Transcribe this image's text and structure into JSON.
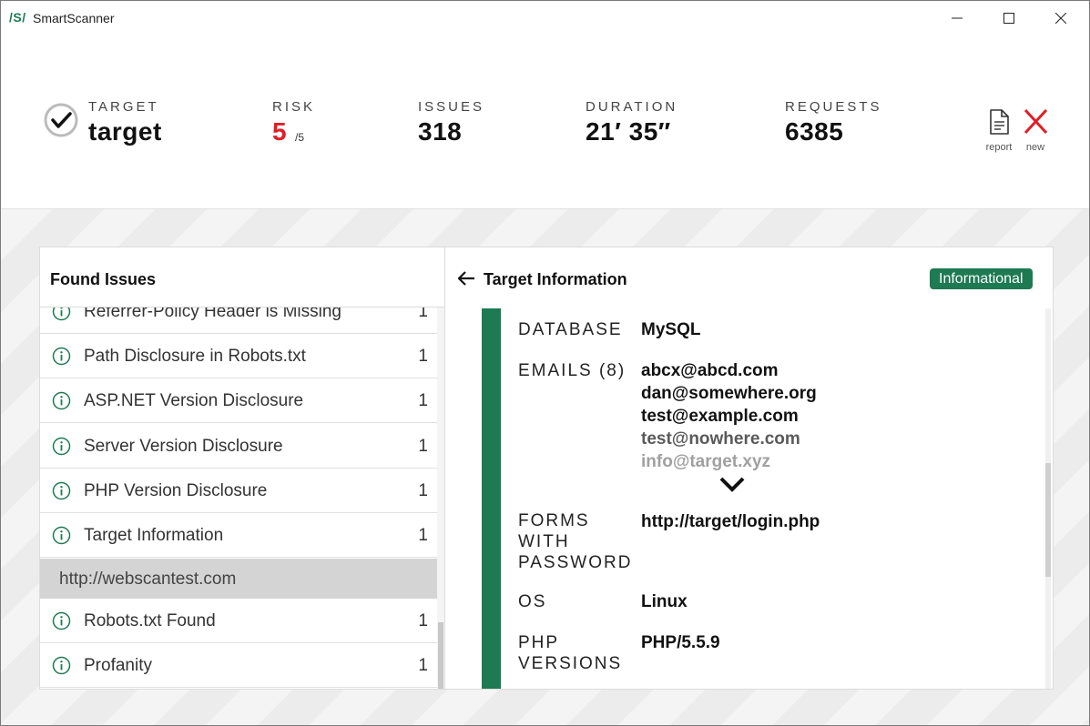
{
  "window": {
    "logo": "/S/",
    "title": "SmartScanner"
  },
  "stats": {
    "target": {
      "label": "TARGET",
      "value": "target"
    },
    "risk": {
      "label": "RISK",
      "value": "5",
      "max": "/5"
    },
    "issues": {
      "label": "ISSUES",
      "value": "318"
    },
    "duration": {
      "label": "DURATION",
      "value": "21′ 35″"
    },
    "requests": {
      "label": "REQUESTS",
      "value": "6385"
    }
  },
  "actions": {
    "report_label": "report",
    "new_label": "new"
  },
  "colors": {
    "accent": "#1d7a52",
    "risk": "#e01e27",
    "group_bg": "#d4d4d4"
  },
  "found_issues": {
    "title": "Found Issues",
    "items": [
      {
        "label": "Referrer-Policy Header is Missing",
        "count": "1",
        "icon": "info-circle-icon"
      },
      {
        "label": "Path Disclosure in Robots.txt",
        "count": "1",
        "icon": "info-circle-icon"
      },
      {
        "label": "ASP.NET Version Disclosure",
        "count": "1",
        "icon": "info-circle-icon"
      },
      {
        "label": "Server Version Disclosure",
        "count": "1",
        "icon": "info-circle-icon"
      },
      {
        "label": "PHP Version Disclosure",
        "count": "1",
        "icon": "info-circle-icon"
      },
      {
        "label": "Target Information",
        "count": "1",
        "icon": "info-circle-icon"
      }
    ],
    "group": {
      "label": "http://webscantest.com"
    },
    "group_items": [
      {
        "label": "Robots.txt Found",
        "count": "1",
        "icon": "info-circle-icon"
      },
      {
        "label": "Profanity",
        "count": "1",
        "icon": "info-circle-icon"
      }
    ]
  },
  "detail": {
    "title": "Target Information",
    "severity": "Informational",
    "fields": {
      "database": {
        "label": "DATABASE",
        "value": "MySQL"
      },
      "emails": {
        "label": "EMAILS (8)",
        "values": [
          "abcx@abcd.com",
          "dan@somewhere.org",
          "test@example.com",
          "test@nowhere.com",
          "info@target.xyz"
        ]
      },
      "forms": {
        "label_lines": [
          "FORMS",
          "WITH",
          "PASSWORD"
        ],
        "value": "http://target/login.php"
      },
      "os": {
        "label": "OS",
        "value": "Linux"
      },
      "php": {
        "label_lines": [
          "PHP",
          "VERSIONS"
        ],
        "value": "PHP/5.5.9"
      }
    }
  }
}
